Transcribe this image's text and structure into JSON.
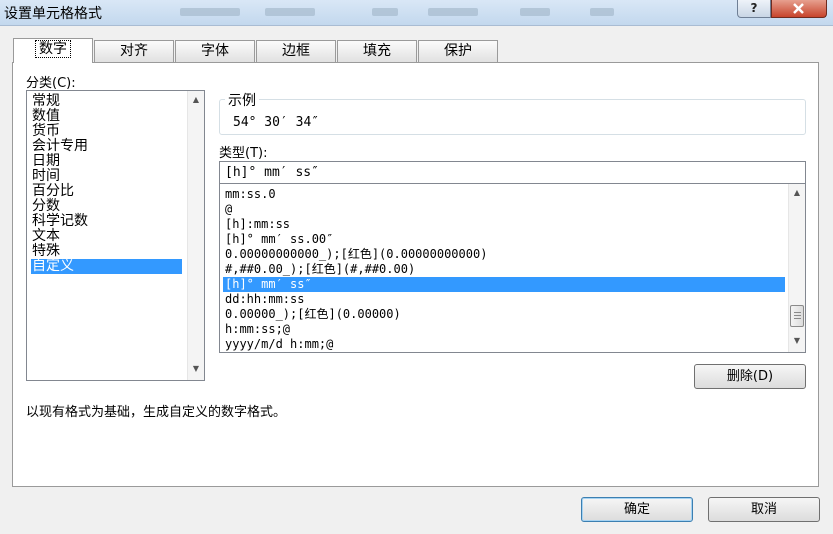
{
  "window": {
    "title": "设置单元格格式",
    "help_label": "?"
  },
  "tabs": [
    {
      "label": "数字"
    },
    {
      "label": "对齐"
    },
    {
      "label": "字体"
    },
    {
      "label": "边框"
    },
    {
      "label": "填充"
    },
    {
      "label": "保护"
    }
  ],
  "category": {
    "label": "分类(C):",
    "items": [
      "常规",
      "数值",
      "货币",
      "会计专用",
      "日期",
      "时间",
      "百分比",
      "分数",
      "科学记数",
      "文本",
      "特殊",
      "自定义"
    ],
    "selected": "自定义"
  },
  "sample": {
    "caption": "示例",
    "value": "54° 30′ 34″"
  },
  "type": {
    "label": "类型(T):",
    "value": "[h]° mm′ ss″"
  },
  "formats": {
    "items": [
      "mm:ss.0",
      "@",
      "[h]:mm:ss",
      "[h]° mm′ ss.00″",
      "0.00000000000_);[红色](0.00000000000)",
      "#,##0.00_);[红色](#,##0.00)",
      "[h]° mm′ ss″",
      "dd:hh:mm:ss",
      "0.00000_);[红色](0.00000)",
      "h:mm:ss;@",
      "yyyy/m/d h:mm;@"
    ],
    "selected": "[h]° mm′ ss″"
  },
  "delete_button": "删除(D)",
  "description": "以现有格式为基础，生成自定义的数字格式。",
  "ok_button": "确定",
  "cancel_button": "取消"
}
